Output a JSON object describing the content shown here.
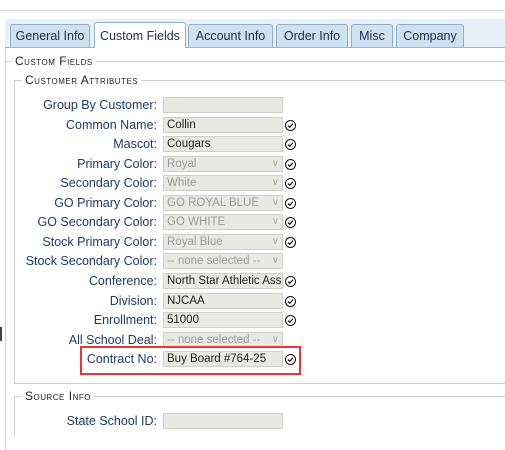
{
  "tabs": [
    {
      "label": "General Info"
    },
    {
      "label": "Custom Fields",
      "active": true
    },
    {
      "label": "Account Info"
    },
    {
      "label": "Order Info"
    },
    {
      "label": "Misc"
    },
    {
      "label": "Company"
    }
  ],
  "sections": {
    "custom_fields": "Custom Fields",
    "customer_attributes": "Customer Attributes",
    "source_info": "Source Info"
  },
  "fields": [
    {
      "label": "Group By Customer:",
      "value": "",
      "type": "text",
      "check": false
    },
    {
      "label": "Common Name:",
      "value": "Collin",
      "type": "text",
      "check": true
    },
    {
      "label": "Mascot:",
      "value": "Cougars",
      "type": "text",
      "check": true
    },
    {
      "label": "Primary Color:",
      "value": "Royal",
      "type": "select",
      "check": true
    },
    {
      "label": "Secondary Color:",
      "value": "White",
      "type": "select",
      "check": true
    },
    {
      "label": "GO Primary Color:",
      "value": "GO ROYAL BLUE",
      "type": "select",
      "check": true
    },
    {
      "label": "GO Secondary Color:",
      "value": "GO WHITE",
      "type": "select",
      "check": true
    },
    {
      "label": "Stock Primary Color:",
      "value": "Royal Blue",
      "type": "select",
      "check": true
    },
    {
      "label": "Stock Secondary Color:",
      "value": "-- none selected --",
      "type": "select",
      "check": false
    },
    {
      "label": "Conference:",
      "value": "North Star Athletic Ass",
      "type": "text",
      "check": true
    },
    {
      "label": "Division:",
      "value": "NJCAA",
      "type": "text",
      "check": true
    },
    {
      "label": "Enrollment:",
      "value": "51000",
      "type": "text",
      "check": true
    },
    {
      "label": "All School Deal:",
      "value": "-- none selected --",
      "type": "select",
      "check": false
    },
    {
      "label": "Contract No:",
      "value": "Buy Board #764-25",
      "type": "text",
      "check": true
    }
  ],
  "source_fields": [
    {
      "label": "State School ID:",
      "value": "",
      "type": "text",
      "check": false
    }
  ],
  "icons": {
    "check": "check-circle-icon",
    "dropdown": "chevron-down-icon"
  },
  "colors": {
    "highlight": "#e53935",
    "label": "#1d3a6c",
    "tab_bg": "#cfe0ef"
  }
}
